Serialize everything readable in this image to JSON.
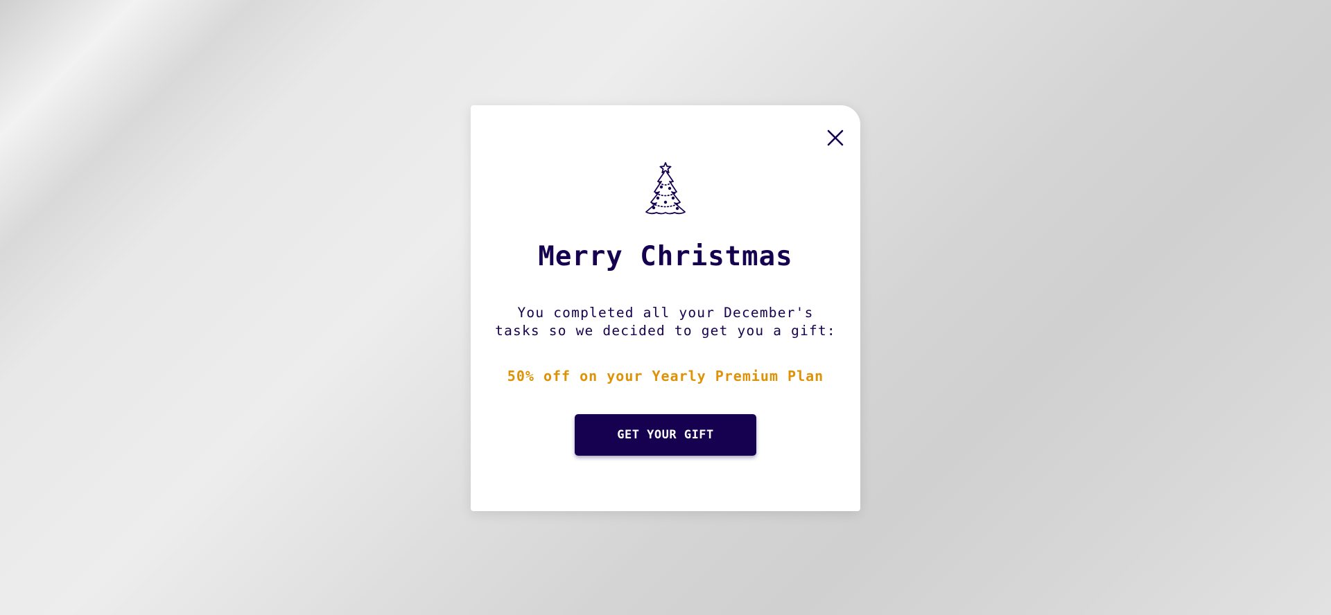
{
  "modal": {
    "close_icon": "close-icon",
    "tree_icon": "christmas-tree-icon",
    "title": "Merry Christmas",
    "message": "You completed all your December's tasks so we decided to get you a gift:",
    "offer": "50% off on your Yearly Premium Plan",
    "button_label": "GET YOUR GIFT"
  },
  "colors": {
    "primary": "#150150",
    "accent": "#de9206",
    "modal_background": "#ffffff"
  }
}
